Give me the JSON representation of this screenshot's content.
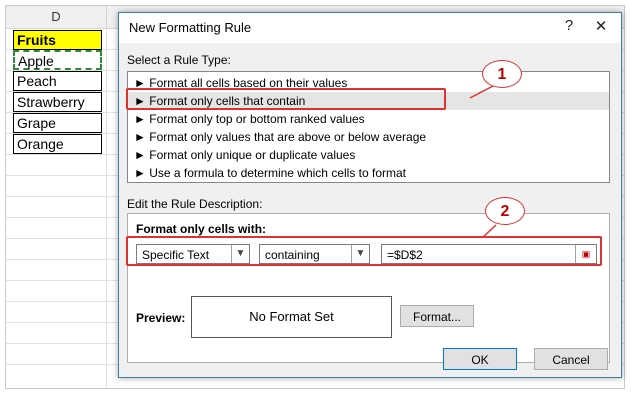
{
  "sheet": {
    "column_header": "D",
    "cells": [
      "Fruits",
      "Apple",
      "Peach",
      "Strawberry",
      "Grape",
      "Orange"
    ]
  },
  "dialog": {
    "title": "New Formatting Rule",
    "help_glyph": "?",
    "close_glyph": "✕",
    "select_rule_type_label": "Select a Rule Type:",
    "rule_types": [
      "Format all cells based on their values",
      "Format only cells that contain",
      "Format only top or bottom ranked values",
      "Format only values that are above or below average",
      "Format only unique or duplicate values",
      "Use a formula to determine which cells to format"
    ],
    "rule_bullet": "►",
    "selected_rule_index": 1,
    "edit_description_label": "Edit the Rule Description:",
    "format_only_cells_with": "Format only cells with:",
    "condition_type": "Specific Text",
    "operator": "containing",
    "value": "=$D$2",
    "preview_label": "Preview:",
    "preview_text": "No Format Set",
    "format_button": "Format...",
    "ok_button": "OK",
    "cancel_button": "Cancel"
  },
  "annotations": [
    "1",
    "2"
  ],
  "colors": {
    "highlight_red": "#e03030",
    "header_yellow": "#ffff00"
  }
}
